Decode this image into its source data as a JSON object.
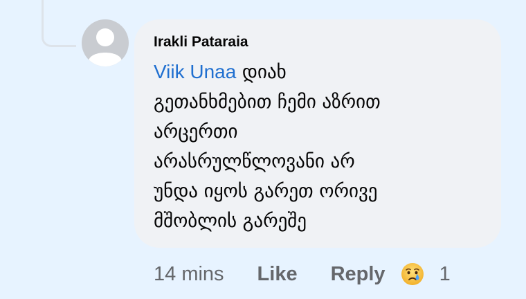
{
  "comment": {
    "author": "Irakli Pataraia",
    "mention": "Viik Unaa",
    "text_lines": [
      " დიახ",
      "გეთანხმებით ჩემი აზრით",
      "არცერთი",
      "არასრულწლოვანი არ",
      "უნდა იყოს გარეთ ორივე",
      "მშობლის გარეშე"
    ]
  },
  "actions": {
    "time": "14 mins",
    "like_label": "Like",
    "reply_label": "Reply",
    "reaction_icon": "crying-face-icon",
    "reaction_count": "1"
  },
  "colors": {
    "background": "#e7f3ff",
    "bubble": "#f0f2f5",
    "mention": "#1f6fd0",
    "muted": "#65676b"
  }
}
